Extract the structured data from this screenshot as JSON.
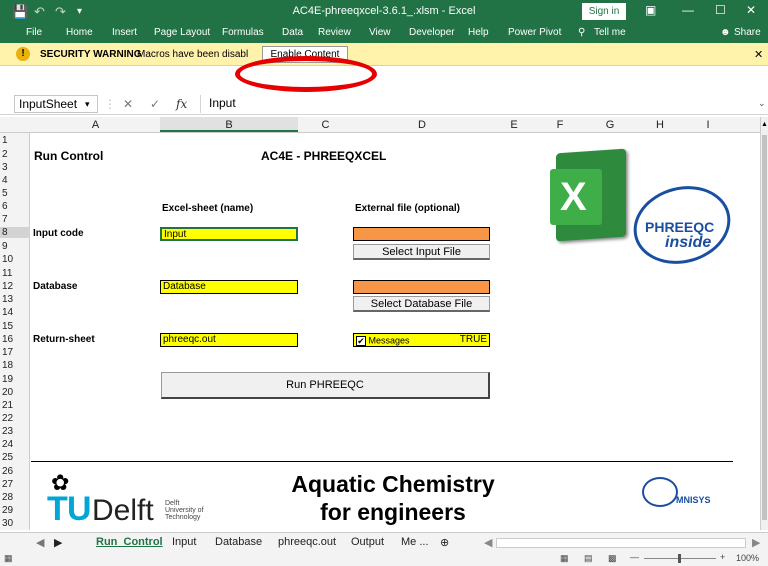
{
  "window": {
    "title": "AC4E-phreeqxcel-3.6.1_.xlsm  -  Excel",
    "sign_in": "Sign in"
  },
  "menu": [
    "File",
    "Home",
    "Insert",
    "Page Layout",
    "Formulas",
    "Data",
    "Review",
    "View",
    "Developer",
    "Help",
    "Power Pivot",
    "Tell me",
    "Share"
  ],
  "security_bar": {
    "label": "SECURITY WARNING",
    "message": "Macros have been disabl",
    "button": "Enable Content"
  },
  "formula_bar": {
    "name_box": "InputSheet",
    "fx": "fx",
    "value": "Input"
  },
  "columns": [
    "A",
    "B",
    "C",
    "D",
    "E",
    "F",
    "G",
    "H",
    "I"
  ],
  "rows": [
    "1",
    "2",
    "3",
    "4",
    "5",
    "6",
    "7",
    "8",
    "9",
    "10",
    "11",
    "12",
    "13",
    "14",
    "15",
    "16",
    "17",
    "18",
    "19",
    "20",
    "21",
    "22",
    "23",
    "24",
    "25",
    "26",
    "27",
    "28",
    "29",
    "30"
  ],
  "sheet": {
    "run_control": "Run Control",
    "app_title": "AC4E - PHREEQXCEL",
    "excel_sheet_header": "Excel-sheet (name)",
    "external_file_header": "External file (optional)",
    "input_code_label": "Input code",
    "input_code_value": "Input",
    "select_input_file": "Select Input File",
    "database_label": "Database",
    "database_value": "Database",
    "select_database_file": "Select Database File",
    "return_sheet_label": "Return-sheet",
    "return_sheet_value": "phreeqc.out",
    "messages_label": "Messages",
    "messages_value": "TRUE",
    "run_button": "Run PHREEQC",
    "logo_text_1": "PHREEQC",
    "logo_text_2": "inside",
    "banner_line1": "Aquatic Chemistry",
    "banner_line2": "for engineers",
    "tudelft": "Delft",
    "tudelft_sub1": "Delft",
    "tudelft_sub2": "University of",
    "tudelft_sub3": "Technology",
    "omnisys": "MNISYS"
  },
  "tabs": [
    "Run_Control",
    "Input",
    "Database",
    "phreeqc.out",
    "Output",
    "Me ..."
  ],
  "status": {
    "zoom": "100%"
  },
  "colors": {
    "excel_green": "#217346",
    "cell_yellow": "#ffff00",
    "cell_orange": "#f79646",
    "warning_bar": "#fff2ab",
    "highlight_ring": "#e60000",
    "logo_blue": "#1a4fa0"
  }
}
